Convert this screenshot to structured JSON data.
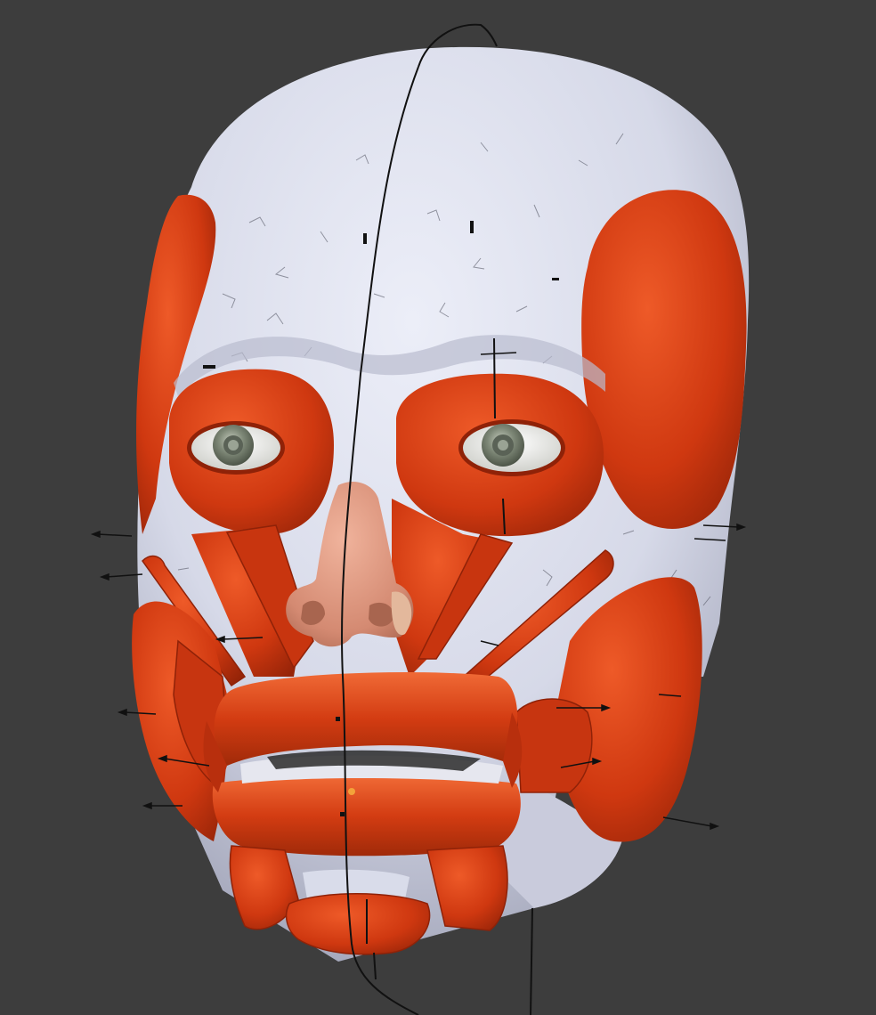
{
  "scene": {
    "background": "#3d3d3d",
    "subject": "skull-with-facial-muscles",
    "colors": {
      "bone": "#d9dcea",
      "bone_shadow": "#a8abbd",
      "muscle": "#d13a12",
      "muscle_dark": "#8f2208",
      "muscle_light": "#ef6a3a",
      "nose": "#d9917a",
      "nose_shadow": "#b06a55",
      "eye_white": "#f2f2ee",
      "iris": "#7d8777",
      "pupil": "#5a6256",
      "guide_line": "#111111"
    }
  }
}
